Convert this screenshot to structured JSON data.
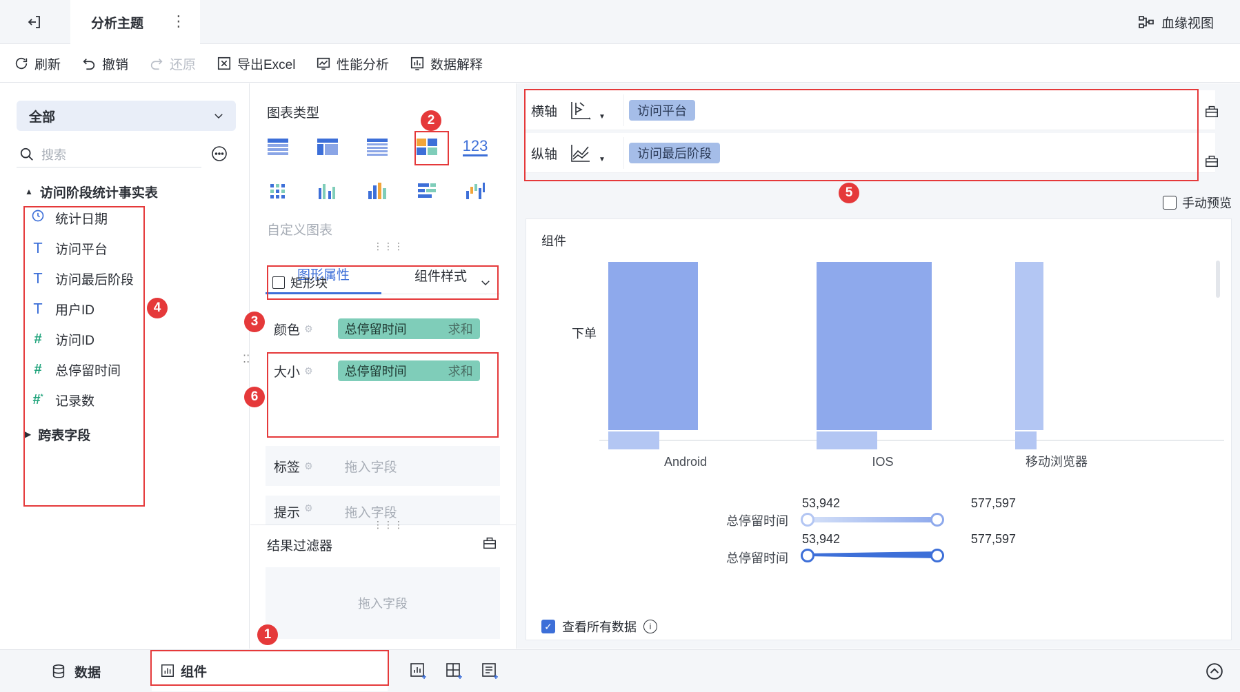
{
  "topbar": {
    "tab_title": "分析主题",
    "lineage_label": "血缘视图"
  },
  "toolbar": {
    "refresh": "刷新",
    "undo": "撤销",
    "redo": "还原",
    "export": "导出Excel",
    "perf": "性能分析",
    "explain": "数据解释"
  },
  "left": {
    "select_value": "全部",
    "search_placeholder": "搜索",
    "table_name": "访问阶段统计事实表",
    "fields": [
      {
        "name": "统计日期"
      },
      {
        "name": "访问平台"
      },
      {
        "name": "访问最后阶段"
      },
      {
        "name": "用户ID"
      },
      {
        "name": "访问ID"
      },
      {
        "name": "总停留时间"
      },
      {
        "name": "记录数"
      }
    ],
    "cross_table": "跨表字段"
  },
  "mid": {
    "chart_types_title": "图表类型",
    "number_icon": "123",
    "custom_chart": "自定义图表",
    "tab_graph": "图形属性",
    "tab_style": "组件样式",
    "mark_type": "矩形块",
    "color_label": "颜色",
    "size_label": "大小",
    "label_label": "标签",
    "tooltip_label": "提示",
    "color_field": "总停留时间",
    "color_agg": "求和",
    "size_field": "总停留时间",
    "size_agg": "求和",
    "drop_placeholder": "拖入字段",
    "result_filter": "结果过滤器",
    "filter_placeholder": "拖入字段"
  },
  "right": {
    "x_axis_label": "横轴",
    "x_axis_field": "访问平台",
    "y_axis_label": "纵轴",
    "y_axis_field": "访问最后阶段",
    "manual_preview": "手动预览",
    "card_title": "组件",
    "y_category": "下单",
    "legend_color_title": "总停留时间",
    "legend_size_title": "总停留时间",
    "legend_min": "53,942",
    "legend_max": "577,597",
    "view_all": "查看所有数据"
  },
  "chart_data": {
    "type": "bar",
    "categories": [
      "Android",
      "IOS",
      "移动浏览器"
    ],
    "y_categories": [
      "下单"
    ],
    "legend_range": [
      53942,
      577597
    ]
  },
  "bottom": {
    "data_tab": "数据",
    "component_tab": "组件"
  },
  "badges": [
    "1",
    "2",
    "3",
    "4",
    "5",
    "6"
  ],
  "colors": {
    "accent": "#3d6fd8",
    "highlight": "#e5393a",
    "bar": "#8ea9ec",
    "bar_light": "#b3c6f3",
    "field_green": "#7fcdb9"
  }
}
